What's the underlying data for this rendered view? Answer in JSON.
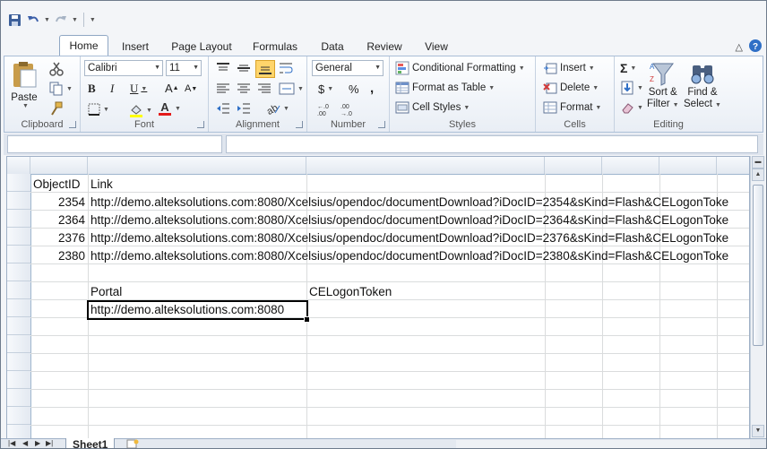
{
  "tabs": [
    "Home",
    "Insert",
    "Page Layout",
    "Formulas",
    "Data",
    "Review",
    "View"
  ],
  "ribbon": {
    "clipboard": {
      "paste": "Paste",
      "label": "Clipboard"
    },
    "font": {
      "name": "Calibri",
      "size": "11",
      "label": "Font"
    },
    "alignment": {
      "label": "Alignment"
    },
    "number": {
      "format": "General",
      "dollar": "$",
      "percent": "%",
      "comma": ",",
      "label": "Number"
    },
    "styles": {
      "conditional": "Conditional Formatting",
      "table": "Format as Table",
      "cell_styles": "Cell Styles",
      "label": "Styles"
    },
    "cells": {
      "insert": "Insert",
      "delete": "Delete",
      "format": "Format",
      "label": "Cells"
    },
    "editing": {
      "sort": "Sort &",
      "sort2": "Filter",
      "find": "Find &",
      "find2": "Select",
      "label": "Editing"
    }
  },
  "sheet": {
    "headers": {
      "objectid": "ObjectID",
      "link": "Link"
    },
    "rows": [
      {
        "id": "2354",
        "link": "http://demo.alteksolutions.com:8080/Xcelsius/opendoc/documentDownload?iDocID=2354&sKind=Flash&CELogonToke"
      },
      {
        "id": "2364",
        "link": "http://demo.alteksolutions.com:8080/Xcelsius/opendoc/documentDownload?iDocID=2364&sKind=Flash&CELogonToke"
      },
      {
        "id": "2376",
        "link": "http://demo.alteksolutions.com:8080/Xcelsius/opendoc/documentDownload?iDocID=2376&sKind=Flash&CELogonToke"
      },
      {
        "id": "2380",
        "link": "http://demo.alteksolutions.com:8080/Xcelsius/opendoc/documentDownload?iDocID=2380&sKind=Flash&CELogonToke"
      }
    ],
    "portal_label": "Portal",
    "token_label": "CELogonToken",
    "portal_value": "http://demo.alteksolutions.com:8080"
  },
  "sheet_tab": "Sheet1"
}
